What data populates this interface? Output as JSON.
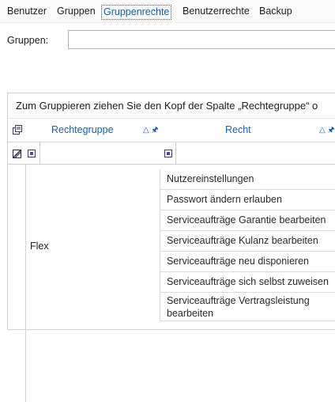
{
  "tabs": {
    "benutzer": "Benutzer",
    "gruppen": "Gruppen",
    "gruppenrechte": "Gruppenrechte",
    "benutzerrechte": "Benutzerrechte",
    "backup": "Backup"
  },
  "filter": {
    "gruppen_label": "Gruppen:",
    "gruppen_value": ""
  },
  "grid": {
    "group_hint": "Zum Gruppieren ziehen Sie den Kopf der Spalte „Rechtegruppe“ o",
    "columns": {
      "rechtegruppe": "Rechtegruppe",
      "recht": "Recht"
    },
    "group": "Flex",
    "rows": [
      "Nutzereinstellungen",
      "Passwort ändern erlauben",
      "Serviceaufträge Garantie bearbeiten",
      "Serviceaufträge Kulanz bearbeiten",
      "Serviceaufträge neu disponieren",
      "Serviceaufträge sich selbst zuweisen",
      "Serviceaufträge Vertragsleistung bearbeiten"
    ]
  },
  "accent": "#1b5fa8"
}
